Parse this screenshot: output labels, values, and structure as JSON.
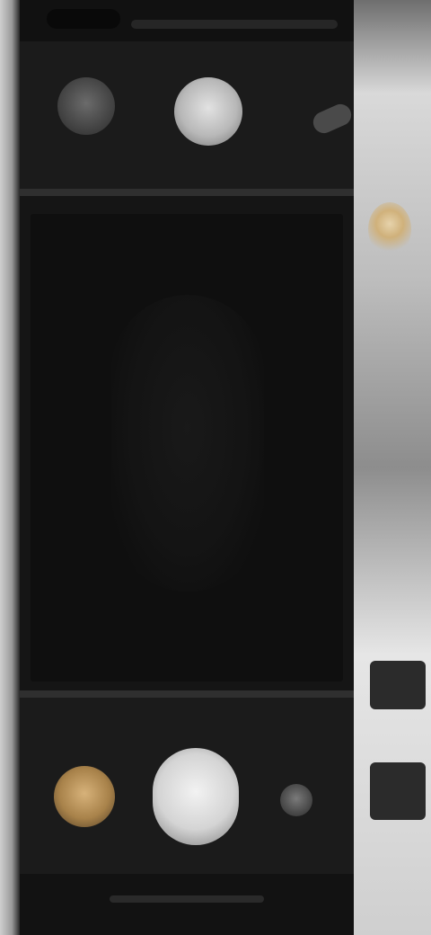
{
  "colors": {
    "background": "#121212",
    "controls_panel": "#1b1b1b",
    "viewfinder": "#0f0f0f",
    "shutter": "#d4d4d4",
    "gallery_thumbnail_accent": "#d7b27a"
  },
  "icons": {
    "top_left": "settings-icon",
    "top_center": "flash-icon",
    "top_right": "zoom-icon",
    "bottom_left": "gallery-thumbnail-icon",
    "bottom_center": "shutter-button-icon",
    "bottom_right": "flip-camera-icon"
  }
}
